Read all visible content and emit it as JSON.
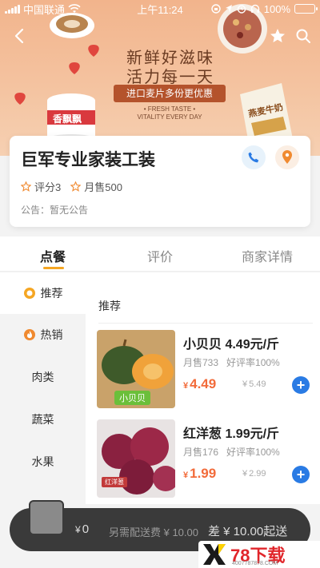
{
  "statusbar": {
    "carrier": "中国联通",
    "time": "上午11:24",
    "battery": "100%"
  },
  "banner": {
    "title_line1": "新鲜好滋味",
    "title_line2": "活力每一天",
    "pill": "进口麦片多份更优惠",
    "sub1": "• FRESH TASTE •",
    "sub2": "VITALITY EVERY DAY",
    "cup_label": "香飘飘",
    "milk_label": "燕麦牛奶"
  },
  "store": {
    "name": "巨军专业家装工装",
    "rating": "评分3",
    "monthly_sales": "月售500",
    "notice": "公告：暂无公告"
  },
  "tabs": [
    "点餐",
    "评价",
    "商家详情"
  ],
  "sidebar": {
    "items": [
      {
        "label": "推荐",
        "icon": "recommend-icon"
      },
      {
        "label": "热销",
        "icon": "fire-icon"
      },
      {
        "label": "肉类"
      },
      {
        "label": "蔬菜"
      },
      {
        "label": "水果"
      }
    ]
  },
  "main": {
    "section_title": "推荐",
    "products": [
      {
        "name": "小贝贝 4.49元/斤",
        "sales": "月售733",
        "positive": "好评率100%",
        "currency": "¥",
        "price": "4.49",
        "old_price": "5.49",
        "image_tag": "小贝贝",
        "color": "#3e5a2a"
      },
      {
        "name": "红洋葱 1.99元/斤",
        "sales": "月售176",
        "positive": "好评率100%",
        "currency": "¥",
        "price": "1.99",
        "old_price": "2.99",
        "image_tag": "红洋葱",
        "color": "#8a2140"
      }
    ]
  },
  "cart": {
    "currency": "¥",
    "amount": "0",
    "delivery": "另需配送费 ¥ 10.00",
    "min_order": "差 ¥ 10.00起送"
  },
  "watermark": {
    "brand": "78下载",
    "url": "4007787878.COM"
  },
  "colors": {
    "accent": "#f5a623",
    "price": "#f26b3a",
    "add_button": "#2a7be4"
  }
}
